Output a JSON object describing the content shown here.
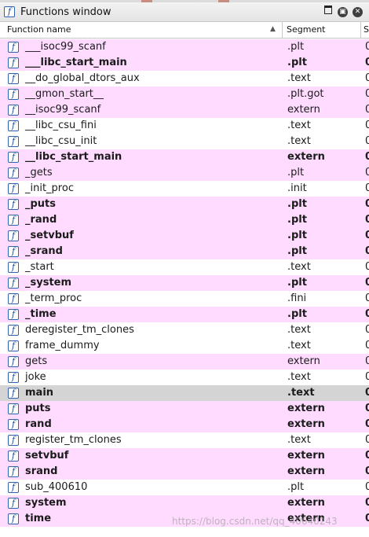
{
  "colors": {
    "row_pink": "#ffdcff",
    "row_white": "#ffffff",
    "row_selected": "#d4d4d4",
    "icon_blue": "#2e63ad"
  },
  "window": {
    "title": "Functions window",
    "title_icon": "function-icon",
    "buttons": [
      "restore-icon",
      "float-icon",
      "close-icon"
    ]
  },
  "columns": {
    "name": "Function name",
    "segment": "Segment",
    "start": "S",
    "sorted_by": "name",
    "sort_direction": "ascending"
  },
  "functions": [
    {
      "name": "___isoc99_scanf",
      "segment": ".plt",
      "start": "0",
      "bold": false,
      "bg": "pink"
    },
    {
      "name": "___libc_start_main",
      "segment": ".plt",
      "start": "0",
      "bold": true,
      "bg": "pink"
    },
    {
      "name": "__do_global_dtors_aux",
      "segment": ".text",
      "start": "0",
      "bold": false,
      "bg": "white"
    },
    {
      "name": "__gmon_start__",
      "segment": ".plt.got",
      "start": "0",
      "bold": false,
      "bg": "pink"
    },
    {
      "name": "__isoc99_scanf",
      "segment": "extern",
      "start": "0",
      "bold": false,
      "bg": "pink"
    },
    {
      "name": "__libc_csu_fini",
      "segment": ".text",
      "start": "0",
      "bold": false,
      "bg": "white"
    },
    {
      "name": "__libc_csu_init",
      "segment": ".text",
      "start": "0",
      "bold": false,
      "bg": "white"
    },
    {
      "name": "__libc_start_main",
      "segment": "extern",
      "start": "0",
      "bold": true,
      "bg": "pink"
    },
    {
      "name": "_gets",
      "segment": ".plt",
      "start": "0",
      "bold": false,
      "bg": "pink"
    },
    {
      "name": "_init_proc",
      "segment": ".init",
      "start": "0",
      "bold": false,
      "bg": "white"
    },
    {
      "name": "_puts",
      "segment": ".plt",
      "start": "0",
      "bold": true,
      "bg": "pink"
    },
    {
      "name": "_rand",
      "segment": ".plt",
      "start": "0",
      "bold": true,
      "bg": "pink"
    },
    {
      "name": "_setvbuf",
      "segment": ".plt",
      "start": "0",
      "bold": true,
      "bg": "pink"
    },
    {
      "name": "_srand",
      "segment": ".plt",
      "start": "0",
      "bold": true,
      "bg": "pink"
    },
    {
      "name": "_start",
      "segment": ".text",
      "start": "0",
      "bold": false,
      "bg": "white"
    },
    {
      "name": "_system",
      "segment": ".plt",
      "start": "0",
      "bold": true,
      "bg": "pink"
    },
    {
      "name": "_term_proc",
      "segment": ".fini",
      "start": "0",
      "bold": false,
      "bg": "white"
    },
    {
      "name": "_time",
      "segment": ".plt",
      "start": "0",
      "bold": true,
      "bg": "pink"
    },
    {
      "name": "deregister_tm_clones",
      "segment": ".text",
      "start": "0",
      "bold": false,
      "bg": "white"
    },
    {
      "name": "frame_dummy",
      "segment": ".text",
      "start": "0",
      "bold": false,
      "bg": "white"
    },
    {
      "name": "gets",
      "segment": "extern",
      "start": "0",
      "bold": false,
      "bg": "pink"
    },
    {
      "name": "joke",
      "segment": ".text",
      "start": "0",
      "bold": false,
      "bg": "white"
    },
    {
      "name": "main",
      "segment": ".text",
      "start": "0",
      "bold": true,
      "bg": "selected"
    },
    {
      "name": "puts",
      "segment": "extern",
      "start": "0",
      "bold": true,
      "bg": "pink"
    },
    {
      "name": "rand",
      "segment": "extern",
      "start": "0",
      "bold": true,
      "bg": "pink"
    },
    {
      "name": "register_tm_clones",
      "segment": ".text",
      "start": "0",
      "bold": false,
      "bg": "white"
    },
    {
      "name": "setvbuf",
      "segment": "extern",
      "start": "0",
      "bold": true,
      "bg": "pink"
    },
    {
      "name": "srand",
      "segment": "extern",
      "start": "0",
      "bold": true,
      "bg": "pink"
    },
    {
      "name": "sub_400610",
      "segment": ".plt",
      "start": "0",
      "bold": false,
      "bg": "white"
    },
    {
      "name": "system",
      "segment": "extern",
      "start": "0",
      "bold": true,
      "bg": "pink"
    },
    {
      "name": "time",
      "segment": "extern",
      "start": "0",
      "bold": true,
      "bg": "pink"
    }
  ],
  "watermark": "https://blog.csdn.net/qq_40640243"
}
